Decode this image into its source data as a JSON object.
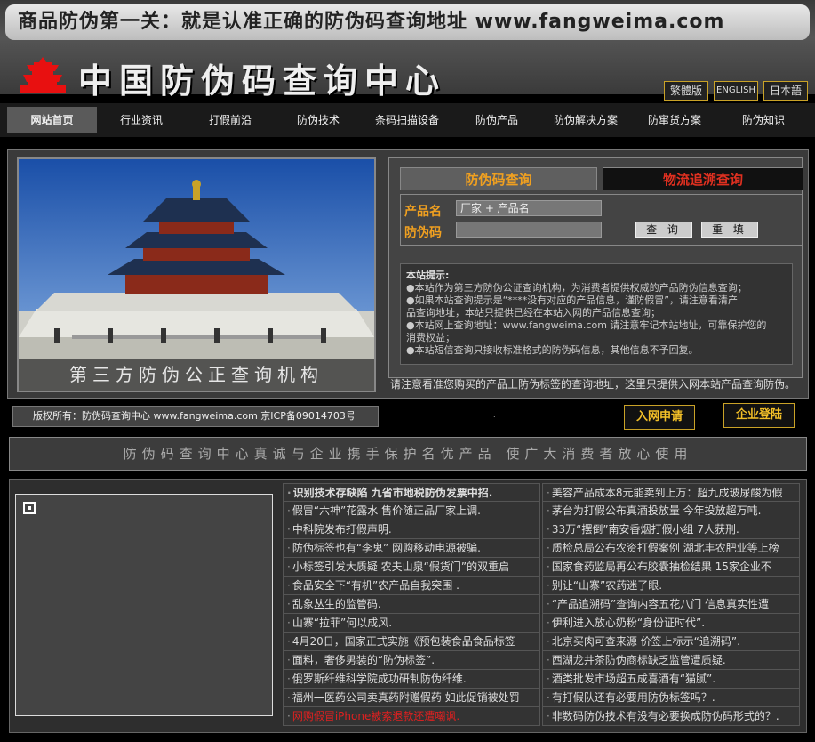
{
  "header": {
    "slogan": "商品防伪第一关：就是认准正确的防伪码查询地址 www.fangweima.com",
    "site_name": "中国防伪码查询中心",
    "languages": [
      "繁體版",
      "ENGLISH",
      "日本語"
    ]
  },
  "nav": {
    "items": [
      "网站首页",
      "行业资讯",
      "打假前沿",
      "防伪技术",
      "条码扫描设备",
      "防伪产品",
      "防伪解决方案",
      "防窜货方案",
      "防伪知识"
    ],
    "active_index": 0
  },
  "photo": {
    "caption": "第三方防伪公正查询机构"
  },
  "query": {
    "tab_anticounterfeit": "防伪码查询",
    "tab_logistics": "物流追溯查询",
    "product_label": "产品名",
    "product_value": "厂家 + 产品名",
    "code_label": "防伪码",
    "code_value": "",
    "query_button": "查 询",
    "reset_button": "重 填",
    "notice_title": "本站提示:",
    "notice_lines": [
      "●本站作为第三方防伪公证查询机构，为消费者提供权威的产品防伪信息查询；",
      "●如果本站查询提示是“****没有对应的产品信息，谨防假冒”，请注意看清产",
      "品查询地址，本站只提供已经在本站入网的产品信息查询；",
      "●本站网上查询地址：www.fangweima.com 请注意牢记本站地址，可靠保护您的",
      "消费权益；",
      "●本站短信查询只接收标准格式的防伪码信息，其他信息不予回复。"
    ],
    "note": "请注意看准您购买的产品上防伪标签的查询地址，这里只提供入网本站产品查询防伪。"
  },
  "footer_bar": {
    "copyright": "版权所有：防伪码查询中心  www.fangweima.com 京ICP备09014703号",
    "dot": ".",
    "join_button": "入网申请",
    "login_button": "企业登陆"
  },
  "mission": "防伪码查询中心真诚与企业携手保护名优产品    使广大消费者放心使用",
  "news": {
    "left": [
      {
        "text": "识别技术存缺陷 九省市地税防伪发票中招.",
        "style": "bold"
      },
      {
        "text": "假冒“六神”花露水  售价随正品厂家上调.",
        "style": ""
      },
      {
        "text": "中科院发布打假声明.",
        "style": ""
      },
      {
        "text": "防伪标签也有“李鬼” 网购移动电源被骗.",
        "style": ""
      },
      {
        "text": "小标签引发大质疑 农夫山泉“假货门”的双重启",
        "style": ""
      },
      {
        "text": "食品安全下“有机”农产品自我突围 .",
        "style": ""
      },
      {
        "text": "乱象丛生的监管码.",
        "style": ""
      },
      {
        "text": "山寨“拉菲”何以成风.",
        "style": ""
      },
      {
        "text": "4月20日，国家正式实施《预包装食品食品标签",
        "style": ""
      },
      {
        "text": "面料，奢侈男装的“防伪标签”.",
        "style": ""
      },
      {
        "text": "俄罗斯纤维科学院成功研制防伪纤维.",
        "style": ""
      },
      {
        "text": "福州一医药公司卖真药附赠假药 如此促销被处罚",
        "style": ""
      },
      {
        "text": "网购假冒iPhone被索退款还遭嘲讽.",
        "style": "red"
      }
    ],
    "right": [
      {
        "text": "美容产品成本8元能卖到上万：超九成玻尿酸为假",
        "style": ""
      },
      {
        "text": "茅台为打假公布真酒投放量 今年投放超万吨.",
        "style": ""
      },
      {
        "text": "33万“摆倒”南安香烟打假小组 7人获刑.",
        "style": ""
      },
      {
        "text": "质检总局公布农资打假案例 湖北丰农肥业等上榜",
        "style": ""
      },
      {
        "text": "国家食药监局再公布胶囊抽检结果 15家企业不",
        "style": ""
      },
      {
        "text": "别让“山寨”农药迷了眼.",
        "style": ""
      },
      {
        "text": "“产品追溯码”查询内容五花八门 信息真实性遭",
        "style": ""
      },
      {
        "text": "伊利进入放心奶粉“身份证时代”.",
        "style": ""
      },
      {
        "text": "北京买肉可查来源 价签上标示“追溯码”.",
        "style": ""
      },
      {
        "text": "西湖龙井茶防伪商标缺乏监管遭质疑.",
        "style": ""
      },
      {
        "text": "酒类批发市场超五成喜酒有“猫腻”.",
        "style": ""
      },
      {
        "text": "有打假队还有必要用防伪标签吗？.",
        "style": ""
      },
      {
        "text": "非数码防伪技术有没有必要换成防伪码形式的？.",
        "style": ""
      }
    ]
  },
  "colors": {
    "accent_gold": "#f3c028",
    "tab_orange": "#f0a020",
    "tab_red": "#e03020"
  },
  "icons": [
    "temple-logo-icon",
    "image-placeholder-icon"
  ]
}
